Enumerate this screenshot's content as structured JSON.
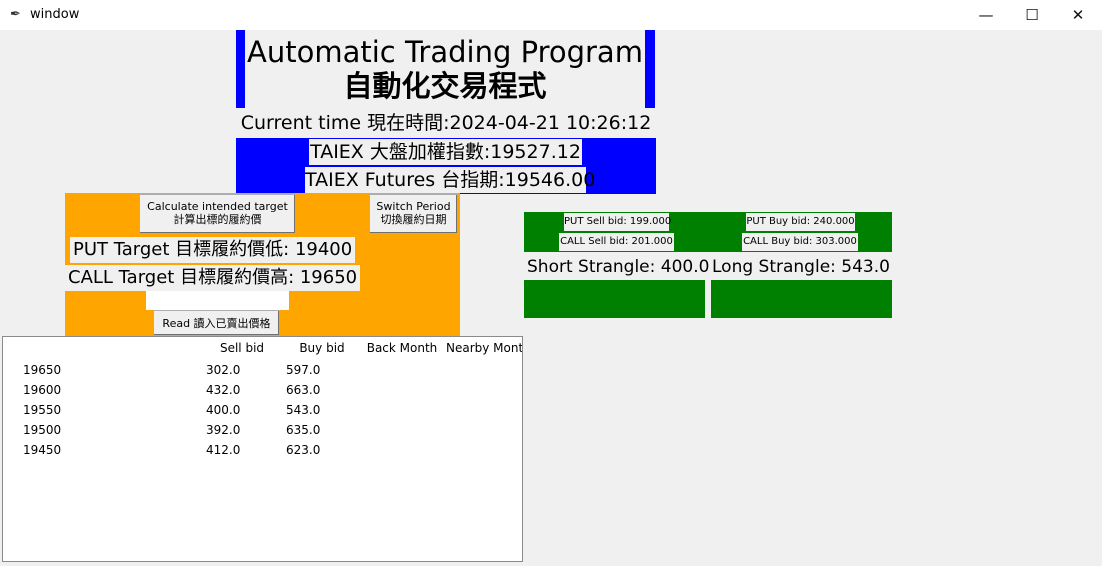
{
  "window": {
    "title": "window",
    "icon": "feather-icon",
    "controls": {
      "minimize": "—",
      "maximize": "☐",
      "close": "✕"
    }
  },
  "header": {
    "title_en": "Automatic Trading Program",
    "title_zh": "自動化交易程式",
    "current_time": "Current time 現在時間:2024-04-21 10:26:12",
    "taiex": "TAIEX 大盤加權指數:19527.12",
    "futures": "TAIEX Futures 台指期:19546.00"
  },
  "controls": {
    "calc_button": "Calculate intended target\n計算出標的履約價",
    "switch_button": "Switch Period\n切換履約日期",
    "put_target": "PUT Target 目標履約價低: 19400",
    "call_target": "CALL Target 目標履約價高: 19650",
    "entry_value": "",
    "read_button": "Read 讀入已賣出價格"
  },
  "table": {
    "columns": [
      "",
      "Sell bid",
      "Buy bid",
      "Back Month",
      "Nearby Month"
    ],
    "rows": [
      [
        "19650",
        "302.0",
        "597.0",
        "",
        ""
      ],
      [
        "19600",
        "432.0",
        "663.0",
        "",
        ""
      ],
      [
        "19550",
        "400.0",
        "543.0",
        "",
        ""
      ],
      [
        "19500",
        "392.0",
        "635.0",
        "",
        ""
      ],
      [
        "19450",
        "412.0",
        "623.0",
        "",
        ""
      ]
    ]
  },
  "quotes": {
    "put_sell": "PUT Sell bid: 199.000",
    "put_buy": "PUT Buy bid: 240.000",
    "call_sell": "CALL Sell bid: 201.000",
    "call_buy": "CALL Buy bid: 303.000",
    "short_strangle": "Short Strangle: 400.0",
    "long_strangle": "Long Strangle: 543.0"
  },
  "colors": {
    "blue": "#0000ff",
    "orange": "#ffa500",
    "green": "#008000",
    "background": "#f0f0f0"
  }
}
